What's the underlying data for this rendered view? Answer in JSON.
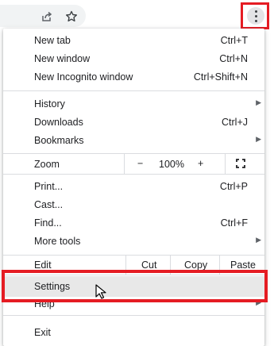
{
  "menu": {
    "new_tab": {
      "label": "New tab",
      "shortcut": "Ctrl+T"
    },
    "new_window": {
      "label": "New window",
      "shortcut": "Ctrl+N"
    },
    "new_incognito": {
      "label": "New Incognito window",
      "shortcut": "Ctrl+Shift+N"
    },
    "history": {
      "label": "History"
    },
    "downloads": {
      "label": "Downloads",
      "shortcut": "Ctrl+J"
    },
    "bookmarks": {
      "label": "Bookmarks"
    },
    "zoom": {
      "label": "Zoom",
      "minus": "−",
      "value": "100%",
      "plus": "+"
    },
    "print": {
      "label": "Print...",
      "shortcut": "Ctrl+P"
    },
    "cast": {
      "label": "Cast..."
    },
    "find": {
      "label": "Find...",
      "shortcut": "Ctrl+F"
    },
    "more_tools": {
      "label": "More tools"
    },
    "edit": {
      "label": "Edit",
      "cut": "Cut",
      "copy": "Copy",
      "paste": "Paste"
    },
    "settings": {
      "label": "Settings"
    },
    "help": {
      "label": "Help"
    },
    "exit": {
      "label": "Exit"
    }
  },
  "icons": {
    "share": "share-icon",
    "bookmark_star": "star-icon",
    "kebab": "three-dot-menu-icon",
    "submenu_arrow": "chevron-right-icon",
    "fullscreen": "fullscreen-icon",
    "cursor": "mouse-pointer-icon"
  },
  "colors": {
    "highlight_outline": "#e51c23",
    "hover_background": "#e8e8e8",
    "divider": "#dadce0"
  }
}
